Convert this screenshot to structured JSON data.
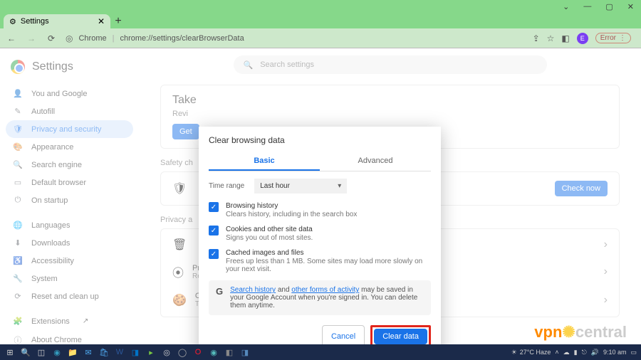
{
  "window": {
    "tab_title": "Settings",
    "url_label": "Chrome",
    "url": "chrome://settings/clearBrowserData",
    "avatar_letter": "E",
    "error_chip": "Error"
  },
  "settings": {
    "title": "Settings",
    "search_placeholder": "Search settings",
    "privacy_section": "Privacy a",
    "safety_section": "Safety ch"
  },
  "sidebar": {
    "items": [
      {
        "icon": "👤",
        "label": "You and Google"
      },
      {
        "icon": "✎",
        "label": "Autofill"
      },
      {
        "icon": "🛡",
        "label": "Privacy and security",
        "active": true
      },
      {
        "icon": "🎨",
        "label": "Appearance"
      },
      {
        "icon": "🔍",
        "label": "Search engine"
      },
      {
        "icon": "▭",
        "label": "Default browser"
      },
      {
        "icon": "⏻",
        "label": "On startup"
      }
    ],
    "items2": [
      {
        "icon": "🌐",
        "label": "Languages"
      },
      {
        "icon": "⬇",
        "label": "Downloads"
      },
      {
        "icon": "♿",
        "label": "Accessibility"
      },
      {
        "icon": "🔧",
        "label": "System"
      },
      {
        "icon": "⟳",
        "label": "Reset and clean up"
      }
    ],
    "items3": [
      {
        "icon": "🧩",
        "label": "Extensions",
        "ext": "↗"
      },
      {
        "icon": "ⓘ",
        "label": "About Chrome"
      }
    ]
  },
  "cards": {
    "take": {
      "title": "Take",
      "sub": "Revi",
      "btn": "Get"
    },
    "check_now": "Check now",
    "clear": {
      "icon": "🗑",
      "title": "",
      "sub": ""
    },
    "guide": {
      "icon": "⦿",
      "title": "Privacy Guide",
      "sub": "Review key privacy and security controls"
    },
    "cookies": {
      "icon": "🍪",
      "title": "Cookies and other site data",
      "sub": "Third-party cookies are blocked in Incognito mode"
    }
  },
  "modal": {
    "title": "Clear browsing data",
    "tab_basic": "Basic",
    "tab_advanced": "Advanced",
    "range_label": "Time range",
    "range_value": "Last hour",
    "items": [
      {
        "title": "Browsing history",
        "sub": "Clears history, including in the search box"
      },
      {
        "title": "Cookies and other site data",
        "sub": "Signs you out of most sites."
      },
      {
        "title": "Cached images and files",
        "sub": "Frees up less than 1 MB. Some sites may load more slowly on your next visit."
      }
    ],
    "info_link1": "Search history",
    "info_mid": " and ",
    "info_link2": "other forms of activity",
    "info_rest": " may be saved in your Google Account when you're signed in. You can delete them anytime.",
    "cancel": "Cancel",
    "clear": "Clear data"
  },
  "watermark": {
    "p1": "vpn",
    "p2": "central"
  },
  "taskbar": {
    "weather": "27°C Haze",
    "time": "9:10 am"
  }
}
